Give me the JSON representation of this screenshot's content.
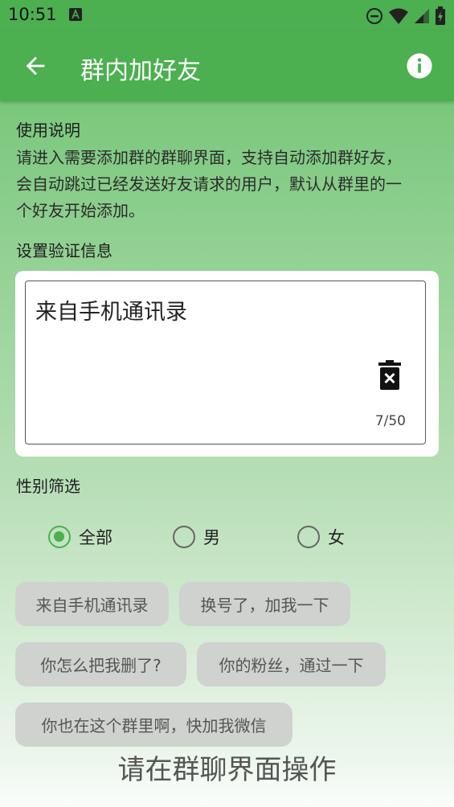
{
  "status_bar": {
    "time": "10:51",
    "icons": [
      "a-notification-icon",
      "do-not-disturb-icon",
      "wifi-icon",
      "signal-icon",
      "battery-icon"
    ]
  },
  "app_bar": {
    "title": "群内加好友",
    "back_icon": "arrow-back-icon",
    "info_icon": "info-icon",
    "color": "#4caf50"
  },
  "instructions": {
    "title": "使用说明",
    "lines": [
      "请进入需要添加群的群聊界面，支持自动添加群好友，",
      "会自动跳过已经发送好友请求的用户，默认从群里的一",
      "个好友开始添加。"
    ]
  },
  "verification": {
    "title": "设置验证信息",
    "value": "来自手机通讯录",
    "counter": "7/50",
    "delete_icon": "trash-x-icon"
  },
  "gender_filter": {
    "title": "性别筛选",
    "options": [
      {
        "label": "全部",
        "checked": true
      },
      {
        "label": "男",
        "checked": false
      },
      {
        "label": "女",
        "checked": false
      }
    ],
    "accent": "#4caf50"
  },
  "presets": [
    "来自手机通讯录",
    "换号了，加我一下",
    "你怎么把我删了?",
    "你的粉丝，通过一下",
    "你也在这个群里啊，快加我微信"
  ],
  "bottom_hint": "请在群聊界面操作"
}
